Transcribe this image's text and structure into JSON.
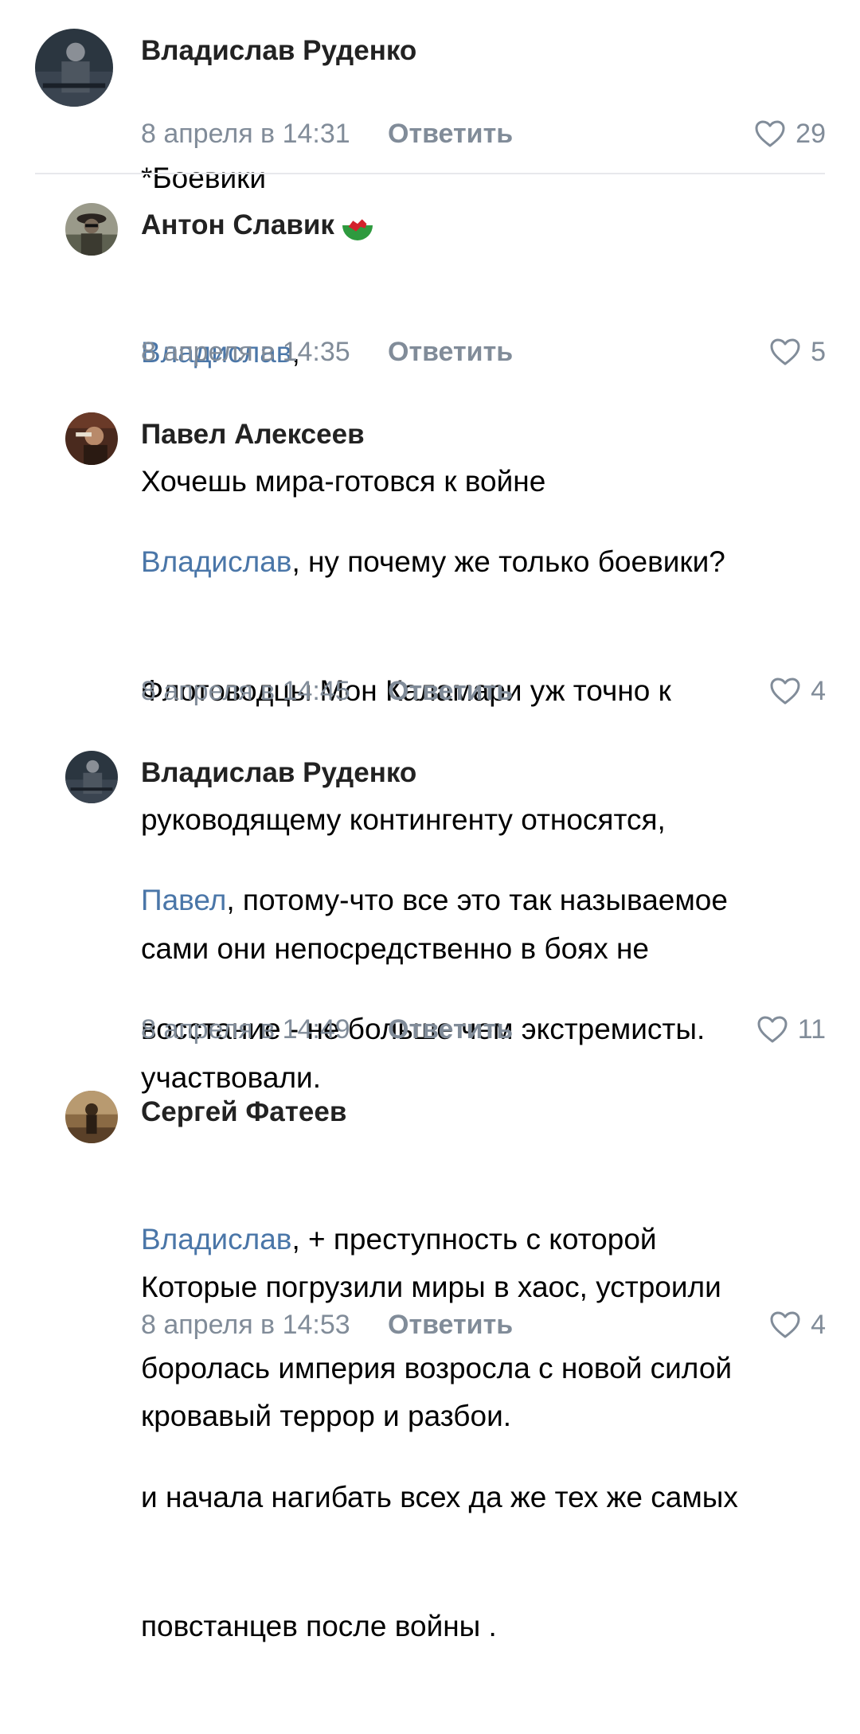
{
  "reply_label": "Ответить",
  "colors": {
    "mention": "#4a76a8",
    "meta": "#818c99",
    "author": "#222222"
  },
  "comments": [
    {
      "author": "Владислав Руденко",
      "lines": [
        {
          "text": "*Боевики"
        }
      ],
      "date": "8 апреля в 14:31",
      "likes": "29",
      "avatar_icon": "user-avatar"
    },
    {
      "author": "Антон Славик",
      "badge_icon": "wales-flag-icon",
      "lines": [
        {
          "mention": "Владислав",
          "text": ","
        },
        {
          "text": "Хочешь мира-готовся к войне"
        }
      ],
      "date": "8 апреля в 14:35",
      "likes": "5",
      "avatar_icon": "user-avatar"
    },
    {
      "author": "Павел Алексеев",
      "lines": [
        {
          "mention": "Владислав",
          "text": ", ну почему же только боевики?"
        },
        {
          "text": "Флотоводцы Мон Каламари уж точно к"
        },
        {
          "text": "руководящему контингенту относятся,"
        },
        {
          "text": "сами они непосредственно в боях не"
        },
        {
          "text": "участвовали."
        }
      ],
      "date": "8 апреля в 14:45",
      "likes": "4",
      "avatar_icon": "user-avatar"
    },
    {
      "author": "Владислав Руденко",
      "lines": [
        {
          "mention": "Павел",
          "text": ", потому-что все это так называемое"
        },
        {
          "text": "восстание - не больше чем экстремисты."
        },
        {
          "text": ""
        },
        {
          "text": "Которые погрузили миры в хаос, устроили"
        },
        {
          "text": "кровавый террор и разбои."
        }
      ],
      "date": "8 апреля в 14:49",
      "likes": "11",
      "avatar_icon": "user-avatar"
    },
    {
      "author": "Сергей Фатеев",
      "lines": [
        {
          "mention": "Владислав",
          "text": ", + преступность с которой"
        },
        {
          "text": "боролась империя возросла с новой силой"
        },
        {
          "text": "и начала нагибать всех да же тех же самых"
        },
        {
          "text": "повстанцев после войны ."
        }
      ],
      "date": "8 апреля в 14:53",
      "likes": "4",
      "avatar_icon": "user-avatar"
    }
  ]
}
